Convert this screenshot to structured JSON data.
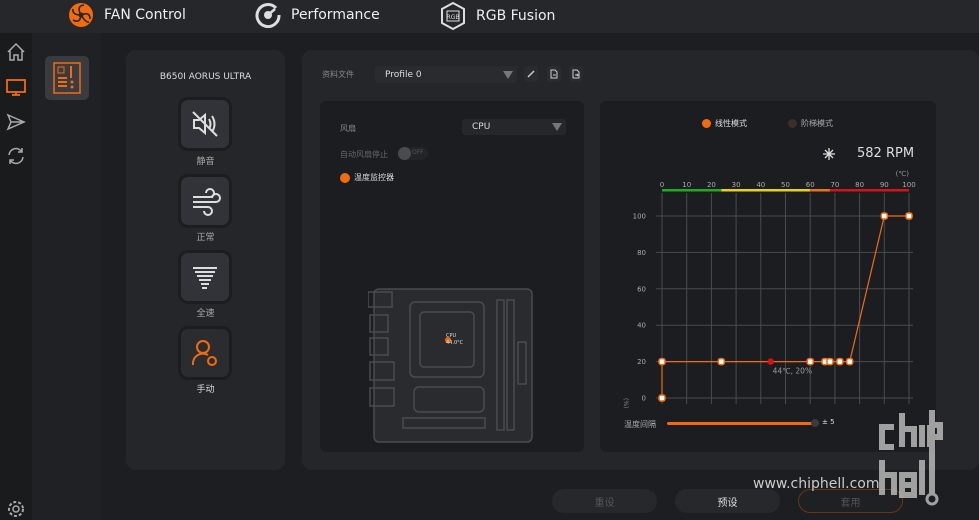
{
  "topbar": {
    "tabs": [
      {
        "label": "FAN Control",
        "icon": "fan-icon",
        "active": true
      },
      {
        "label": "Performance",
        "icon": "gauge-icon"
      },
      {
        "label": "RGB Fusion",
        "icon": "rgb-icon"
      }
    ]
  },
  "colors": {
    "accent": "#f26b10",
    "grid": "#4a4b50",
    "current": "#e01010"
  },
  "device": {
    "name": "B650I AORUS ULTRA"
  },
  "modes": [
    {
      "label": "静音",
      "icon": "mute-icon"
    },
    {
      "label": "正常",
      "icon": "wind-icon"
    },
    {
      "label": "全速",
      "icon": "tornado-icon"
    },
    {
      "label": "手动",
      "icon": "manual-user-icon",
      "active": true
    }
  ],
  "profile": {
    "label": "资料文件",
    "value": "Profile 0"
  },
  "fan": {
    "label": "风扇",
    "value": "CPU",
    "auto_stop_label": "自动风扇停止",
    "auto_stop_state": "OFF",
    "monitor_label": "温度监控器",
    "cpu_label": "CPU",
    "cpu_temp": "44.0°C"
  },
  "curve": {
    "mode_linear": "线性模式",
    "mode_step": "阶梯模式",
    "rpm": "582 RPM",
    "interval_label": "温度间隔",
    "interval_value": "± 5",
    "interval_fraction": 1.0
  },
  "chart_data": {
    "type": "line",
    "x_unit": "(℃)",
    "y_unit": "(%)",
    "xlim": [
      0,
      100
    ],
    "ylim": [
      0,
      100
    ],
    "x_ticks": [
      0,
      10,
      20,
      30,
      40,
      50,
      60,
      70,
      80,
      90,
      100
    ],
    "y_ticks": [
      0,
      20,
      40,
      60,
      80,
      100
    ],
    "points": [
      [
        0,
        0
      ],
      [
        0,
        20
      ],
      [
        24,
        20
      ],
      [
        60,
        20
      ],
      [
        66,
        20
      ],
      [
        68,
        20
      ],
      [
        72,
        20
      ],
      [
        76,
        20
      ],
      [
        90,
        100
      ],
      [
        100,
        100
      ]
    ],
    "current": {
      "x": 44,
      "y": 20,
      "label": "44℃, 20%"
    },
    "temp_bands": [
      {
        "from": 0,
        "to": 24,
        "color": "#1faa1f"
      },
      {
        "from": 24,
        "to": 60,
        "color": "#e6d21a"
      },
      {
        "from": 60,
        "to": 68,
        "color": "#e8731a"
      },
      {
        "from": 68,
        "to": 100,
        "color": "#d4141a"
      }
    ],
    "grid": true
  },
  "buttons": {
    "reset": "重设",
    "default": "预设",
    "apply": "套用"
  },
  "watermark": {
    "url": "www.chiphell.com",
    "logo": "chip hell"
  }
}
